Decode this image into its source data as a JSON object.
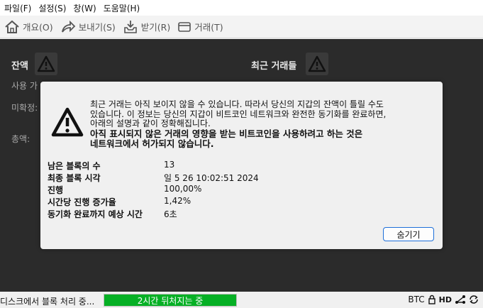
{
  "menu": [
    "파일(F)",
    "설정(S)",
    "창(W)",
    "도움말(H)"
  ],
  "toolbar": {
    "overview": "개요(O)",
    "send": "보내기(S)",
    "receive": "받기(R)",
    "transactions": "거래(T)"
  },
  "background": {
    "balance_title": "잔액",
    "available_label": "사용 가",
    "pending_label": "미확정:",
    "total_label": "총액:",
    "recent_title": "최근 거래들"
  },
  "modal": {
    "message_1": "최근 거래는 아직 보이지 않을 수 있습니다. 따라서 당신의 지갑의 잔액이 틀릴 수도",
    "message_2": "있습니다. 이 정보는 당신의 지갑이 비트코인 네트워크와 완전한 동기화를 완료하면,",
    "message_3": "아래의 설명과 같이 정확해집니다.",
    "warning_1": "아직 표시되지 않은 거래의 영향을 받는 비트코인을 사용하려고 하는 것은",
    "warning_2": "네트워크에서 허가되지 않습니다.",
    "stats": [
      {
        "label": "남은 블록의 수",
        "value": "13"
      },
      {
        "label": "최종 블록 시각",
        "value": "일 5 26 10:02:51 2024"
      },
      {
        "label": "진행",
        "value": "100,00%"
      },
      {
        "label": "시간당 진행 증가율",
        "value": "1,42%"
      },
      {
        "label": "동기화 완료까지 예상 시간",
        "value": "6초"
      }
    ],
    "hide_label": "숨기기"
  },
  "status": {
    "text": "디스크에서 블록 처리 중...",
    "progress_text": "2시간 뒤처지는 중",
    "progress_value": 1.0,
    "unit": "BTC",
    "hd": "HD"
  },
  "colors": {
    "progress": "#06b025",
    "main_bg": "#2b2b2b",
    "button_border": "#1e6fd9"
  }
}
